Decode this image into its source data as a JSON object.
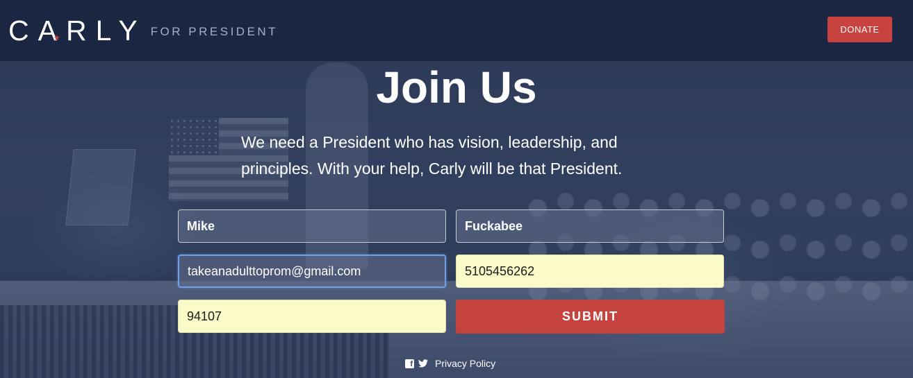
{
  "header": {
    "logo_name": "CARLY",
    "logo_tagline": "FOR PRESIDENT",
    "donate_label": "DONATE"
  },
  "main": {
    "title": "Join Us",
    "subtitle_line1": "We need a President who has vision, leadership, and",
    "subtitle_line2": "principles. With your help, Carly will be that President."
  },
  "form": {
    "first_name": "Mike",
    "last_name": "Fuckabee",
    "email": "takeanadulttoprom@gmail.com",
    "phone": "5105456262",
    "zip": "94107",
    "submit_label": "SUBMIT"
  },
  "footer": {
    "privacy_label": "Privacy Policy"
  },
  "colors": {
    "header_bg": "#1a2642",
    "accent_red": "#c8423f",
    "autofill_bg": "#fafbc8"
  },
  "icons": [
    "star-icon",
    "facebook-icon",
    "twitter-icon"
  ]
}
